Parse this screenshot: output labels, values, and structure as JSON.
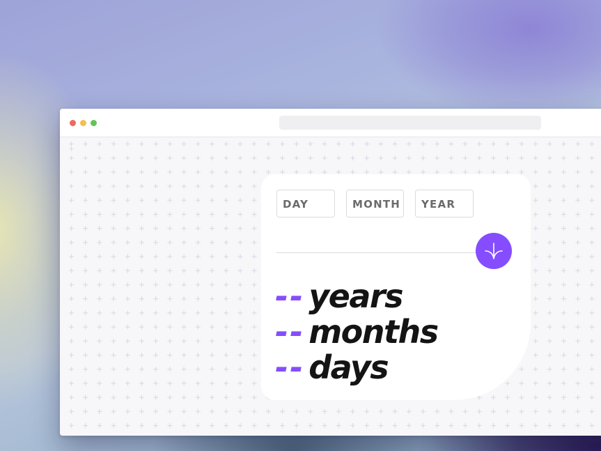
{
  "form": {
    "day_placeholder": "DAY",
    "month_placeholder": "MONTH",
    "year_placeholder": "YEAR"
  },
  "submit": {
    "icon": "arrow-down-icon",
    "color": "#854dff"
  },
  "results": {
    "years_value": "--",
    "years_label": "years",
    "months_value": "--",
    "months_label": "months",
    "days_value": "--",
    "days_label": "days"
  },
  "colors": {
    "accent": "#854dff",
    "text_dark": "#141414",
    "label_gray": "#6b6b6b",
    "window_dot_red": "#ec6a5e",
    "window_dot_yellow": "#f4bf4f",
    "window_dot_green": "#61c554"
  }
}
